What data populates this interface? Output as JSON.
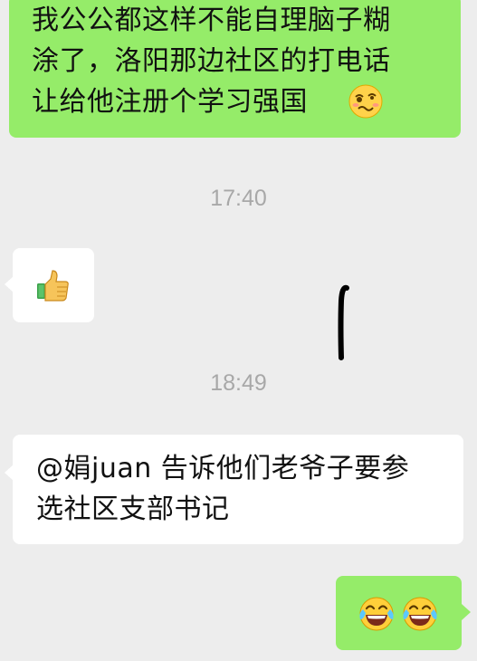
{
  "messages": [
    {
      "side": "right",
      "type": "text",
      "text": "我公公都这样不能自理脑子糊\n涂了，洛阳那边社区的打电话\n让给他注册个学习强国",
      "trailing_emoji": "woozy-face-icon"
    },
    {
      "type": "timestamp",
      "text": "17:40"
    },
    {
      "side": "left",
      "type": "emoji",
      "emoji": "thumbs-up-icon"
    },
    {
      "type": "timestamp",
      "text": "18:49"
    },
    {
      "side": "left",
      "type": "text",
      "text": "@娟juan 告诉他们老爷子要参\n选社区支部书记"
    },
    {
      "side": "right",
      "type": "emoji",
      "emoji": [
        "tears-of-joy-icon",
        "tears-of-joy-icon"
      ]
    }
  ],
  "colors": {
    "background": "#ededed",
    "self_bubble": "#95ec69",
    "other_bubble": "#ffffff",
    "timestamp_text": "#a8a8a8"
  }
}
